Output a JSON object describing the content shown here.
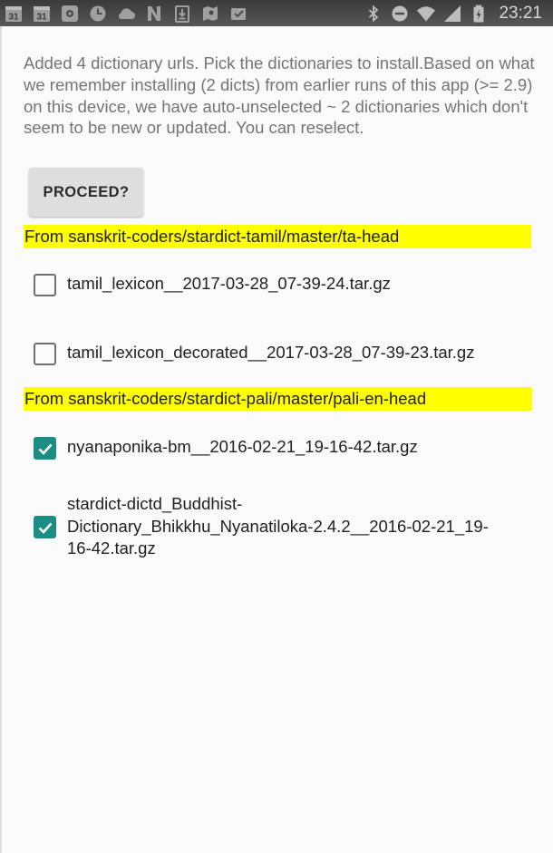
{
  "status_bar": {
    "time": "23:21",
    "left_icons": [
      "calendar-icon",
      "calendar-icon",
      "settings-icon",
      "clock-icon",
      "cloud-icon",
      "n-app-icon",
      "download-icon",
      "maps-icon",
      "inbox-icon"
    ],
    "calendar_day": "31",
    "right_icons": [
      "bluetooth-icon",
      "do-not-disturb-icon",
      "wifi-icon",
      "signal-icon",
      "battery-icon"
    ]
  },
  "message": "Added 4 dictionary urls. Pick the dictionaries to install.Based on what we remember installing (2 dicts) from earlier runs of this app (>= 2.9) on this device, we have auto-unselected ~ 2 dictionaries which don't seem to be new or updated. You can reselect.",
  "proceed_label": "PROCEED?",
  "groups": [
    {
      "header": "From sanskrit-coders/stardict-tamil/master/ta-head",
      "items": [
        {
          "label": "tamil_lexicon__2017-03-28_07-39-24.tar.gz",
          "checked": false
        },
        {
          "label": "tamil_lexicon_decorated__2017-03-28_07-39-23.tar.gz",
          "checked": false
        }
      ]
    },
    {
      "header": "From sanskrit-coders/stardict-pali/master/pali-en-head",
      "items": [
        {
          "label": "nyanaponika-bm__2016-02-21_19-16-42.tar.gz",
          "checked": true
        },
        {
          "label": "stardict-dictd_Buddhist-\nDictionary_Bhikkhu_Nyanatiloka-2.4.2__2016-02-21_19-\n16-42.tar.gz",
          "checked": true
        }
      ]
    }
  ],
  "colors": {
    "status_bar": "#4a4a4a",
    "highlight": "#ffff00",
    "checkbox_checked": "#1a8e83",
    "button": "#dedede",
    "message_text": "#757575"
  }
}
